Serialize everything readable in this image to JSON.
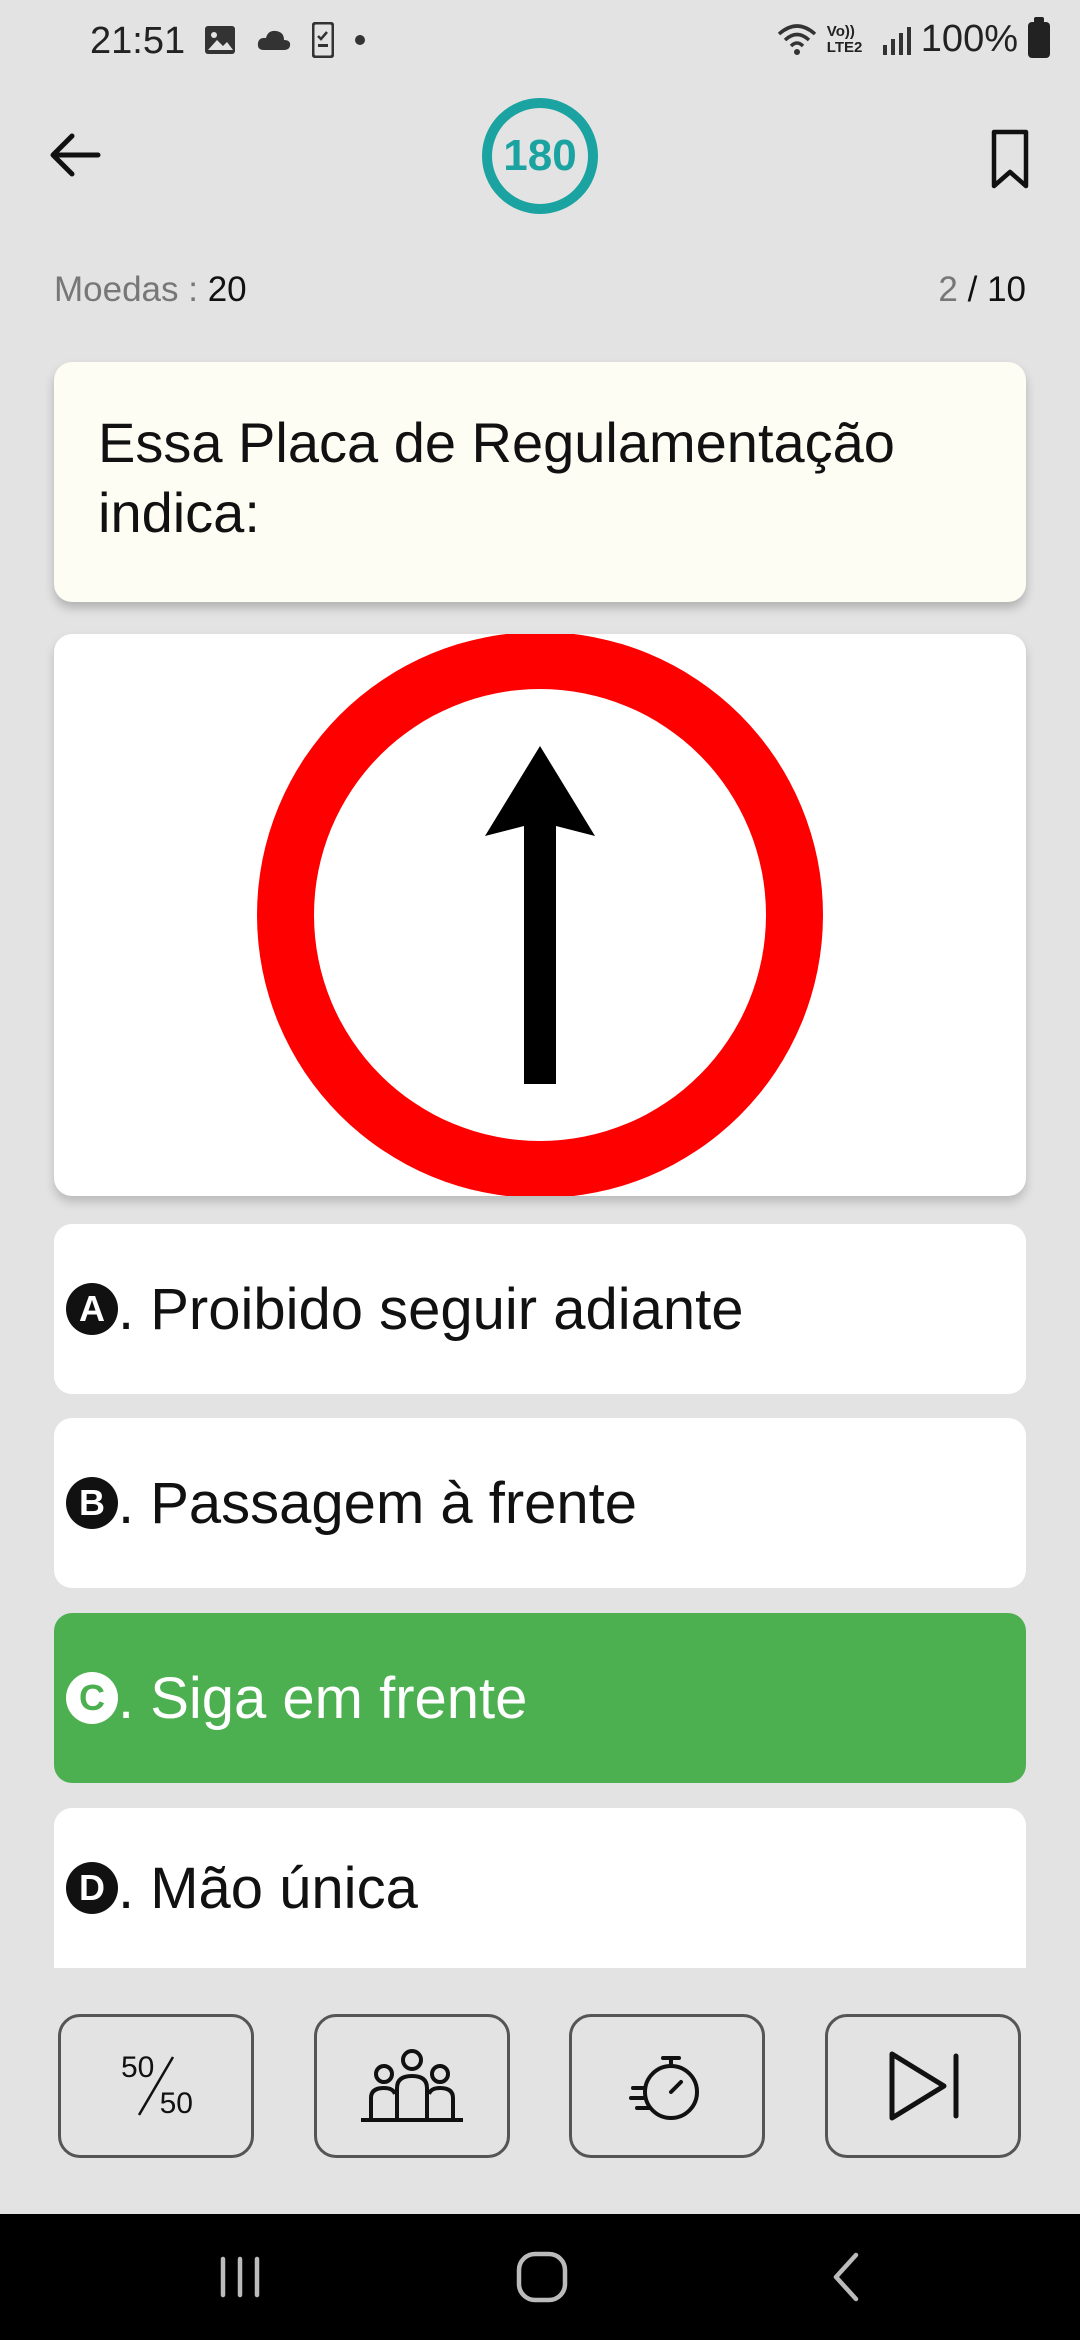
{
  "status_bar": {
    "time": "21:51",
    "battery": "100%",
    "signal_label": "Vo)) LTE2"
  },
  "header": {
    "timer_value": "180"
  },
  "stats": {
    "coins_label": "Moedas : ",
    "coins_value": "20",
    "current_question": "2",
    "separator": " / ",
    "total_questions": "10"
  },
  "question": {
    "text": "Essa Placa de Regulamentação indica:",
    "image": {
      "icon": "regulatory-sign-straight-ahead",
      "ring_color": "#ff0000",
      "arrow_color": "#000000"
    }
  },
  "options": [
    {
      "letter": "A",
      "text": ". Proibido seguir adiante",
      "state": "default"
    },
    {
      "letter": "B",
      "text": ". Passagem à frente",
      "state": "default"
    },
    {
      "letter": "C",
      "text": ". Siga em frente",
      "state": "correct"
    },
    {
      "letter": "D",
      "text": ". Mão única",
      "state": "default"
    }
  ],
  "lifelines": [
    {
      "icon": "fifty-fifty-icon",
      "label_top": "50",
      "label_bottom": "50"
    },
    {
      "icon": "audience-icon"
    },
    {
      "icon": "timer-icon"
    },
    {
      "icon": "skip-icon"
    }
  ],
  "colors": {
    "accent": "#1aa3a1",
    "correct": "#4caf50",
    "background": "#e3e3e3",
    "question_card": "#fdfdf4"
  }
}
